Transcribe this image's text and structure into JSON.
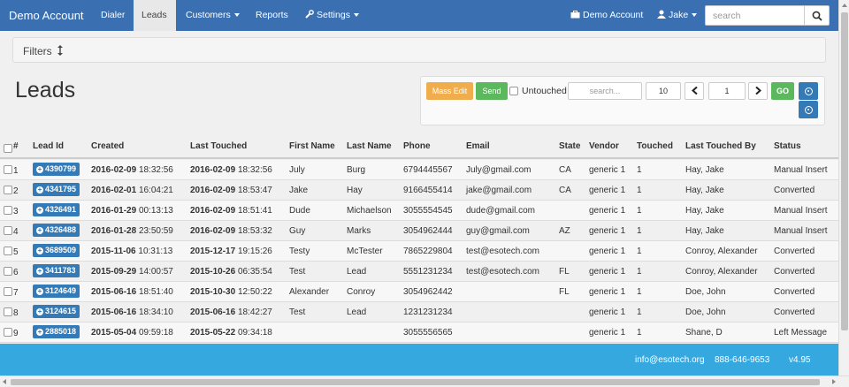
{
  "navbar": {
    "brand": "Demo Account",
    "items": [
      {
        "label": "Dialer"
      },
      {
        "label": "Leads"
      },
      {
        "label": "Customers"
      },
      {
        "label": "Reports"
      },
      {
        "label": "Settings"
      }
    ],
    "account_label": "Demo Account",
    "user_label": "Jake",
    "search_placeholder": "search"
  },
  "filters": {
    "label": "Filters",
    "icon": "vertical-arrows-icon"
  },
  "page_title": "Leads",
  "toolbar": {
    "mass_edit_label": "Mass Edit",
    "send_label": "Send",
    "untouched_label": "Untouched",
    "search_placeholder": "search...",
    "page_size": "10",
    "page_number": "1",
    "go_label": "GO",
    "colors": {
      "mass_edit": "#f0ad4e",
      "send": "#5cb85c",
      "go": "#5cb85c",
      "info": "#337ab7"
    }
  },
  "table": {
    "columns": [
      "#",
      "Lead Id",
      "Created",
      "Last Touched",
      "First Name",
      "Last Name",
      "Phone",
      "Email",
      "State",
      "Vendor",
      "Touched",
      "Last Touched By",
      "Status"
    ],
    "rows": [
      {
        "num": "1",
        "lead_id": "4390799",
        "created_date": "2016-02-09",
        "created_time": "18:32:56",
        "touched_date": "2016-02-09",
        "touched_time": "18:32:56",
        "first": "July",
        "last": "Burg",
        "phone": "6794445567",
        "email": "July@gmail.com",
        "state": "CA",
        "vendor": "generic 1",
        "touched": "1",
        "by": "Hay, Jake",
        "status": "Manual Insert"
      },
      {
        "num": "2",
        "lead_id": "4341795",
        "created_date": "2016-02-01",
        "created_time": "16:04:21",
        "touched_date": "2016-02-09",
        "touched_time": "18:53:47",
        "first": "Jake",
        "last": "Hay",
        "phone": "9166455414",
        "email": "jake@gmail.com",
        "state": "CA",
        "vendor": "generic 1",
        "touched": "1",
        "by": "Hay, Jake",
        "status": "Converted"
      },
      {
        "num": "3",
        "lead_id": "4326491",
        "created_date": "2016-01-29",
        "created_time": "00:13:13",
        "touched_date": "2016-02-09",
        "touched_time": "18:51:41",
        "first": "Dude",
        "last": "Michaelson",
        "phone": "3055554545",
        "email": "dude@gmail.com",
        "state": "",
        "vendor": "generic 1",
        "touched": "1",
        "by": "Hay, Jake",
        "status": "Manual Insert"
      },
      {
        "num": "4",
        "lead_id": "4326488",
        "created_date": "2016-01-28",
        "created_time": "23:50:59",
        "touched_date": "2016-02-09",
        "touched_time": "18:53:32",
        "first": "Guy",
        "last": "Marks",
        "phone": "3054962444",
        "email": "guy@gmail.com",
        "state": "AZ",
        "vendor": "generic 1",
        "touched": "1",
        "by": "Hay, Jake",
        "status": "Manual Insert"
      },
      {
        "num": "5",
        "lead_id": "3689509",
        "created_date": "2015-11-06",
        "created_time": "10:31:13",
        "touched_date": "2015-12-17",
        "touched_time": "19:15:26",
        "first": "Testy",
        "last": "McTester",
        "phone": "7865229804",
        "email": "test@esotech.com",
        "state": "",
        "vendor": "generic 1",
        "touched": "1",
        "by": "Conroy, Alexander",
        "status": "Converted"
      },
      {
        "num": "6",
        "lead_id": "3411783",
        "created_date": "2015-09-29",
        "created_time": "14:00:57",
        "touched_date": "2015-10-26",
        "touched_time": "06:35:54",
        "first": "Test",
        "last": "Lead",
        "phone": "5551231234",
        "email": "test@esotech.com",
        "state": "FL",
        "vendor": "generic 1",
        "touched": "1",
        "by": "Conroy, Alexander",
        "status": "Converted"
      },
      {
        "num": "7",
        "lead_id": "3124649",
        "created_date": "2015-06-16",
        "created_time": "18:51:40",
        "touched_date": "2015-10-30",
        "touched_time": "12:50:22",
        "first": "Alexander",
        "last": "Conroy",
        "phone": "3054962442",
        "email": "",
        "state": "FL",
        "vendor": "generic 1",
        "touched": "1",
        "by": "Doe, John",
        "status": "Converted"
      },
      {
        "num": "8",
        "lead_id": "3124615",
        "created_date": "2015-06-16",
        "created_time": "18:34:10",
        "touched_date": "2015-06-16",
        "touched_time": "18:42:27",
        "first": "Test",
        "last": "Lead",
        "phone": "1231231234",
        "email": "",
        "state": "",
        "vendor": "generic 1",
        "touched": "1",
        "by": "Doe, John",
        "status": "Converted"
      },
      {
        "num": "9",
        "lead_id": "2885018",
        "created_date": "2015-05-04",
        "created_time": "09:59:18",
        "touched_date": "2015-05-22",
        "touched_time": "09:34:18",
        "first": "",
        "last": "",
        "phone": "3055556565",
        "email": "",
        "state": "",
        "vendor": "generic 1",
        "touched": "1",
        "by": "Shane, D",
        "status": "Left Message"
      }
    ]
  },
  "footer": {
    "email": "info@esotech.org",
    "phone": "888-646-9653",
    "version": "v4.95"
  },
  "colors": {
    "navbar": "#3a6fb2",
    "footer": "#35a8e0",
    "badge": "#337ab7"
  }
}
